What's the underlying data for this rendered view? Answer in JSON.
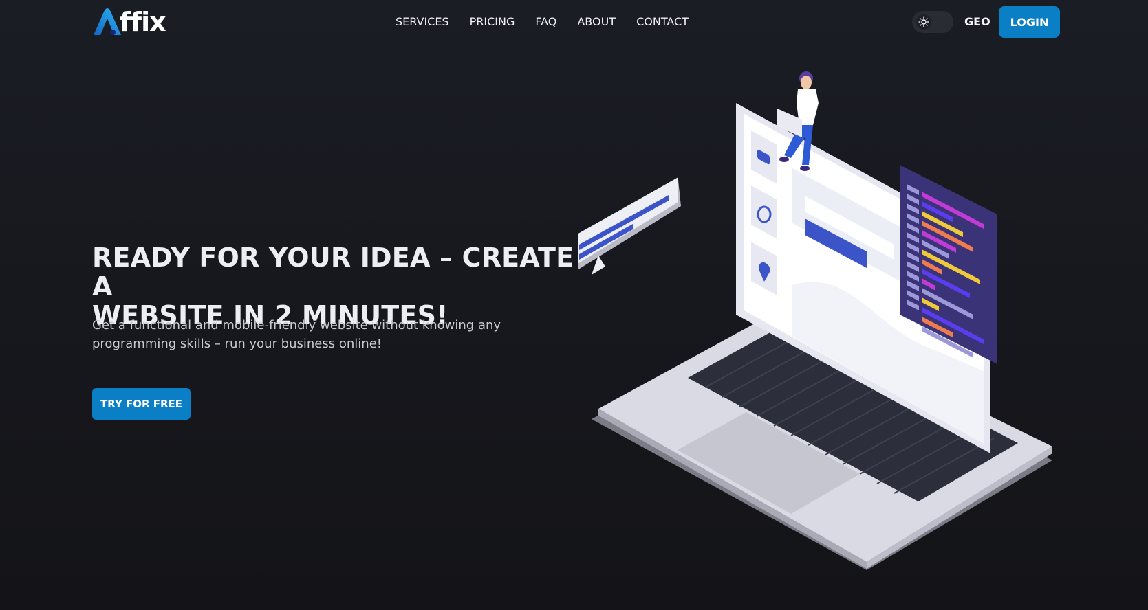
{
  "header": {
    "logo_text": "ffix",
    "logo_icon": "affix-a-logo-icon",
    "nav": [
      {
        "label": "SERVICES"
      },
      {
        "label": "PRICING"
      },
      {
        "label": "FAQ"
      },
      {
        "label": "ABOUT"
      },
      {
        "label": "CONTACT"
      }
    ],
    "theme_toggle_icon": "sun-icon",
    "language": "GEO",
    "login_label": "LOGIN"
  },
  "hero": {
    "title_line1": "READY FOR YOUR IDEA – CREATE A",
    "title_line2": "WEBSITE IN 2 MINUTES!",
    "subtitle": "Get a functional and mobile-friendly website without knowing any programming skills – run your business online!",
    "cta_label": "TRY FOR FREE"
  },
  "illustration": {
    "description_icons": [
      "camera-icon",
      "clock-icon",
      "location-pin-icon"
    ]
  },
  "colors": {
    "accent": "#0a7fc5",
    "background": "#1b1d25",
    "code_panel": "#3b3378"
  }
}
